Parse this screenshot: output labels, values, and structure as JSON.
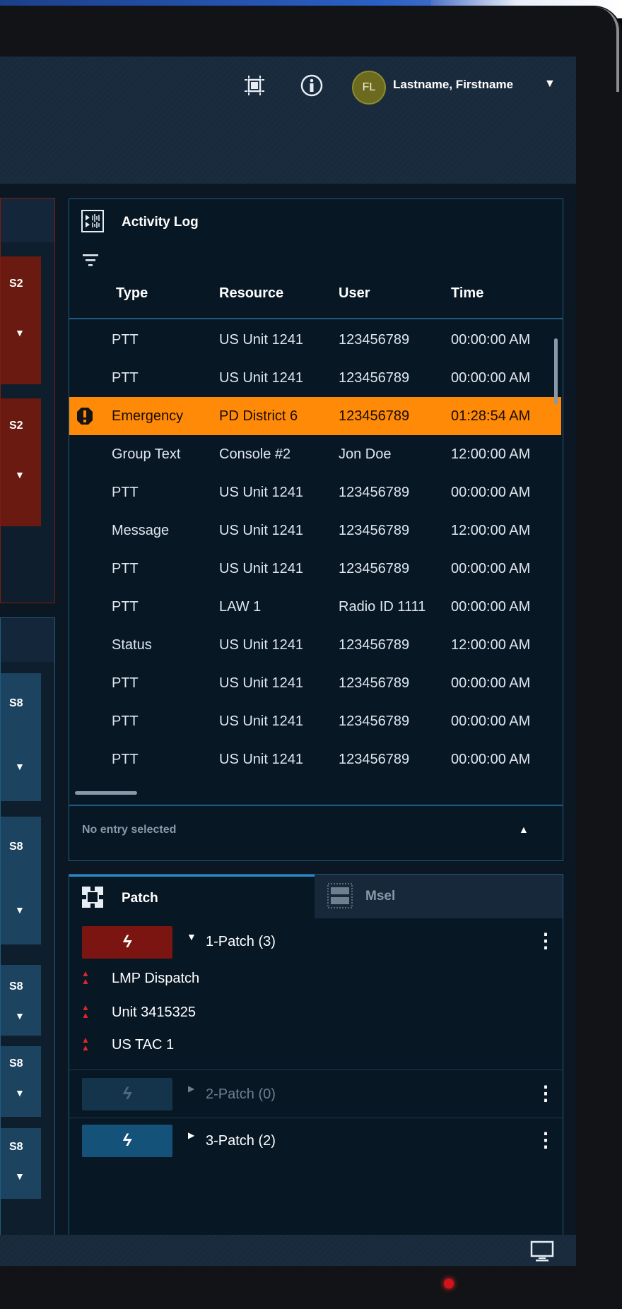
{
  "header": {
    "avatar_initials": "FL",
    "username": "Lastname, Firstname",
    "icons": [
      "fullscreen-icon",
      "info-icon",
      "chevron-down-icon"
    ]
  },
  "left_panels": {
    "top": {
      "tiles": [
        {
          "label": "S2"
        },
        {
          "label": "S2"
        }
      ]
    },
    "bottom": {
      "tiles": [
        {
          "label": "S8"
        },
        {
          "label": "S8"
        },
        {
          "label": "S8"
        },
        {
          "label": "S8"
        },
        {
          "label": "S8"
        }
      ]
    }
  },
  "activity_log": {
    "title": "Activity Log",
    "columns": [
      "Type",
      "Resource",
      "User",
      "Time"
    ],
    "rows": [
      {
        "type": "PTT",
        "resource": "US Unit 1241",
        "user": "123456789",
        "time": "00:00:00 AM"
      },
      {
        "type": "PTT",
        "resource": "US Unit 1241",
        "user": "123456789",
        "time": "00:00:00 AM"
      },
      {
        "type": "Emergency",
        "resource": "PD District 6",
        "user": "123456789",
        "time": "01:28:54 AM",
        "alert": true
      },
      {
        "type": "Group Text",
        "resource": "Console #2",
        "user": "Jon Doe",
        "time": "12:00:00 AM"
      },
      {
        "type": "PTT",
        "resource": "US Unit 1241",
        "user": "123456789",
        "time": "00:00:00 AM"
      },
      {
        "type": "Message",
        "resource": "US Unit 1241",
        "user": "123456789",
        "time": "12:00:00 AM"
      },
      {
        "type": "PTT",
        "resource": "US Unit 1241",
        "user": "123456789",
        "time": "00:00:00 AM"
      },
      {
        "type": "PTT",
        "resource": "LAW 1",
        "user": "Radio ID 1111",
        "time": "00:00:00 AM"
      },
      {
        "type": "Status",
        "resource": "US Unit 1241",
        "user": "123456789",
        "time": "12:00:00 AM"
      },
      {
        "type": "PTT",
        "resource": "US Unit 1241",
        "user": "123456789",
        "time": "00:00:00 AM"
      },
      {
        "type": "PTT",
        "resource": "US Unit 1241",
        "user": "123456789",
        "time": "00:00:00 AM"
      },
      {
        "type": "PTT",
        "resource": "US Unit 1241",
        "user": "123456789",
        "time": "00:00:00 AM"
      }
    ],
    "footer": "No entry selected"
  },
  "patch_panel": {
    "tab_patch": "Patch",
    "tab_msel": "Msel",
    "patches": [
      {
        "name": "1-Patch (3)",
        "expanded": true,
        "color": "#7a1511",
        "members": [
          "LMP Dispatch",
          "Unit 3415325",
          "US TAC 1"
        ]
      },
      {
        "name": "2-Patch (0)",
        "expanded": false,
        "color": "#13344a",
        "members": []
      },
      {
        "name": "3-Patch (2)",
        "expanded": false,
        "color": "#15527a",
        "members": []
      }
    ]
  },
  "colors": {
    "accent_blue": "#2d86c4",
    "emergency": "#ff8a08",
    "alert_red": "#e0262a"
  }
}
